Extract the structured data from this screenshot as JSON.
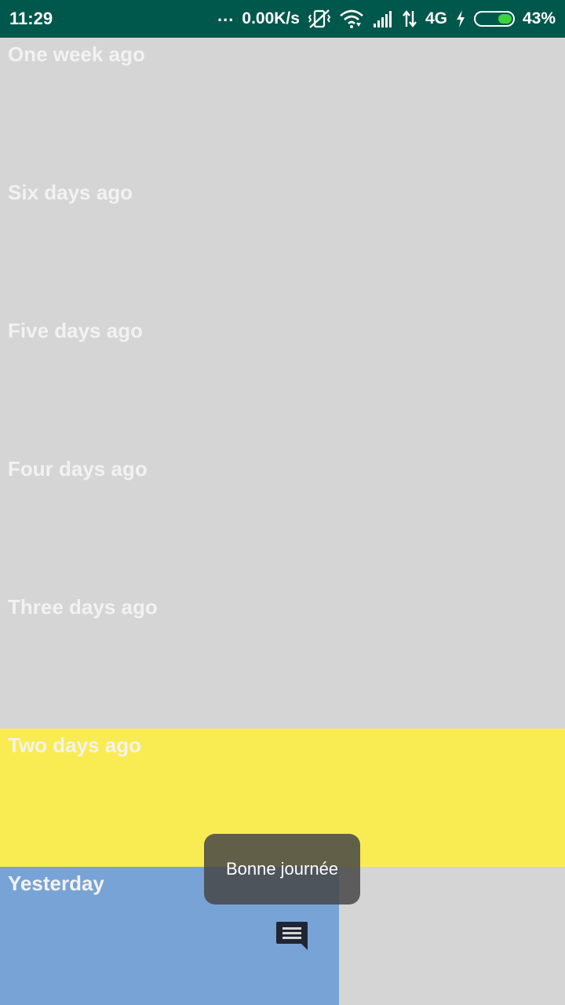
{
  "status_bar": {
    "time": "11:29",
    "dots": "...",
    "network_speed": "0.00K/s",
    "network_type": "4G",
    "battery_percent": "43%",
    "battery_level": 0.43,
    "icons": [
      "vibrate-off-icon",
      "wifi-icon",
      "signal-icon",
      "data-arrows-icon",
      "charging-icon",
      "battery-icon"
    ]
  },
  "timeline": {
    "rows": [
      {
        "label": "One week ago",
        "color": "#d5d5d5"
      },
      {
        "label": "Six days ago",
        "color": "#d5d5d5"
      },
      {
        "label": "Five days ago",
        "color": "#d5d5d5"
      },
      {
        "label": "Four days ago",
        "color": "#d5d5d5"
      },
      {
        "label": "Three days ago",
        "color": "#d5d5d5"
      },
      {
        "label": "Two days ago",
        "color": "#f9ec52"
      },
      {
        "label": "Yesterday",
        "color": "#78a3d6"
      }
    ]
  },
  "toast": {
    "message": "Bonne journée"
  },
  "message_button": {
    "icon": "message-icon"
  }
}
